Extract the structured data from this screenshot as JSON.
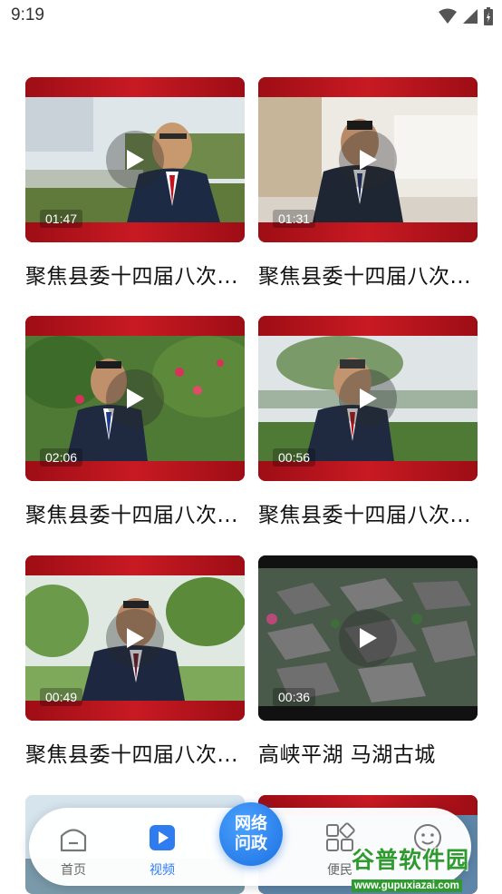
{
  "status_bar": {
    "time": "9:19"
  },
  "videos": [
    {
      "duration": "01:47",
      "title": "聚焦县委十四届八次..."
    },
    {
      "duration": "01:31",
      "title": "聚焦县委十四届八次..."
    },
    {
      "duration": "02:06",
      "title": "聚焦县委十四届八次..."
    },
    {
      "duration": "00:56",
      "title": "聚焦县委十四届八次..."
    },
    {
      "duration": "00:49",
      "title": "聚焦县委十四届八次..."
    },
    {
      "duration": "00:36",
      "title": "高峡平湖 马湖古城"
    }
  ],
  "tabbar": {
    "home": "首页",
    "video": "视频",
    "center_line1": "网络",
    "center_line2": "问政",
    "service": "便民",
    "profile": ""
  },
  "watermark": {
    "name": "谷普软件园",
    "url": "www.gupuxiazai.com"
  },
  "colors": {
    "accent": "#2f7cf0",
    "brand_red": "#c81a23"
  }
}
